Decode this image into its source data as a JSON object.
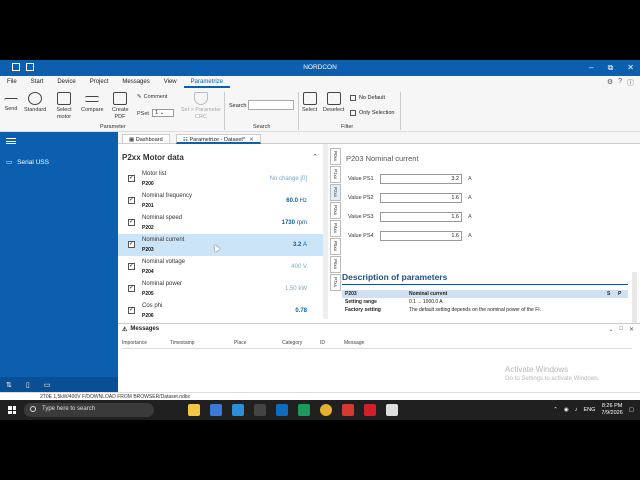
{
  "app": {
    "title": "NORDCON"
  },
  "menu": {
    "items": [
      "File",
      "Start",
      "Device",
      "Project",
      "Messages",
      "View",
      "Parametrize"
    ],
    "active": "Parametrize"
  },
  "ribbon": {
    "send": "Send",
    "standard": "Standard",
    "select_motor": "Select motor",
    "compare": "Compare",
    "create_pdf": "Create PDF",
    "comment": "Comment",
    "pset_label": "PSet",
    "pset_value": "1",
    "set_crc": "Set > Parameter CRC",
    "group_parameter": "Parameter",
    "search_label": "Search",
    "group_search": "Search",
    "select": "Select",
    "deselect": "Deselect",
    "no_default": "No Default",
    "only_selection": "Only Selection",
    "group_filter": "Filter"
  },
  "sidebar": {
    "item": "Serial USS"
  },
  "tabs": [
    {
      "label": "Dashboard"
    },
    {
      "label": "Parametrize - Dataset*"
    }
  ],
  "params": {
    "header": "P2xx Motor data",
    "rows": [
      {
        "name": "Motor list",
        "code": "P200",
        "value": "No change [0]"
      },
      {
        "name": "Nominal frequency",
        "code": "P201",
        "value": "60.0",
        "unit": "Hz"
      },
      {
        "name": "Nominal speed",
        "code": "P202",
        "value": "1730",
        "unit": "rpm"
      },
      {
        "name": "Nominal current",
        "code": "P203",
        "value": "3.2",
        "unit": "A"
      },
      {
        "name": "Nominal voltage",
        "code": "P204",
        "value": "400",
        "unit": "V"
      },
      {
        "name": "Nominal power",
        "code": "P205",
        "value": "1,50",
        "unit": "kW"
      },
      {
        "name": "Cos phi",
        "code": "P206",
        "value": "0.78"
      }
    ]
  },
  "vtabs": [
    "P0xx",
    "P1xx",
    "P2xx",
    "P3xx",
    "P4xx",
    "P5xx",
    "P6xx",
    "P7xx"
  ],
  "detail": {
    "title": "P203 Nominal current",
    "values": [
      {
        "label": "Value PS1",
        "value": "3.2",
        "unit": "A"
      },
      {
        "label": "Value PS2",
        "value": "1.6",
        "unit": "A"
      },
      {
        "label": "Value PS3",
        "value": "1.6",
        "unit": "A"
      },
      {
        "label": "Value PS4",
        "value": "1.6",
        "unit": "A"
      }
    ],
    "desc_header": "Description of parameters",
    "table": {
      "code": "P203",
      "name": "Nominal current",
      "s": "S",
      "p": "P",
      "range_label": "Setting range",
      "range_value": "0.1 ... 1000.0 A",
      "factory_label": "Factory setting",
      "factory_value": "The default setting depends on the nominal power of the FI."
    }
  },
  "messages": {
    "title": "Messages",
    "columns": [
      "Importance",
      "Timestamp",
      "Place",
      "Category",
      "ID",
      "Message"
    ]
  },
  "watermark": {
    "line1": "Activate Windows",
    "line2": "Go to Settings to activate Windows."
  },
  "status_text": "2T0E 1,5kW/400V F/DOWNLOAD FROM BROWSER/Dataset.ndbx",
  "taskbar": {
    "search_placeholder": "Type here to search",
    "lang": "ENG",
    "time": "8:26 PM",
    "date": "7/9/2026"
  }
}
